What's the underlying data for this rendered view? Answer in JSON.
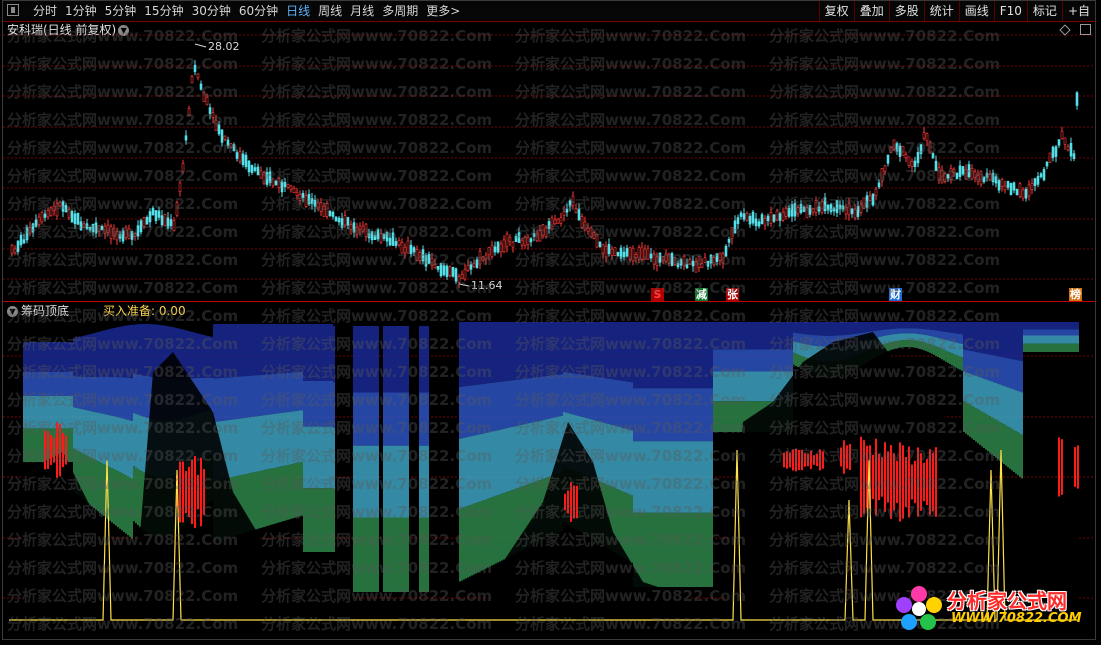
{
  "toolbar": {
    "period_tabs": [
      "分时",
      "1分钟",
      "5分钟",
      "15分钟",
      "30分钟",
      "60分钟",
      "日线",
      "周线",
      "月线",
      "多周期",
      "更多>"
    ],
    "active_tab": "日线",
    "right_tools": [
      "复权",
      "叠加",
      "多股",
      "统计",
      "画线",
      "F10",
      "标记",
      "+自"
    ]
  },
  "main_chart": {
    "title": "安科瑞(日线 前复权)",
    "high_label": "28.02",
    "low_label": "11.64",
    "badges": [
      {
        "text": "S",
        "color": "#b00000",
        "textcolor": "#ff4040"
      },
      {
        "text": "减",
        "color": "#0a7a2a",
        "textcolor": "#ffffff"
      },
      {
        "text": "张",
        "color": "#b00000",
        "textcolor": "#ffffff"
      },
      {
        "text": "财",
        "color": "#1a6ad8",
        "textcolor": "#ffffff"
      },
      {
        "text": "榜",
        "color": "#d07010",
        "textcolor": "#ffffff"
      }
    ]
  },
  "indicator": {
    "title": "筹码顶底",
    "value_text": "买入准备: 0.00"
  },
  "watermark_text": "分析家公式网www.70822.Com",
  "logo": {
    "name": "分析家公式网",
    "url": "WWW.70822.COM"
  },
  "colors": {
    "up": "#ff3b3b",
    "down": "#54e0e8",
    "grid": "#7a0000",
    "indicator_yellow": "#ffe14a",
    "indicator_red": "#ff1a1a"
  }
}
